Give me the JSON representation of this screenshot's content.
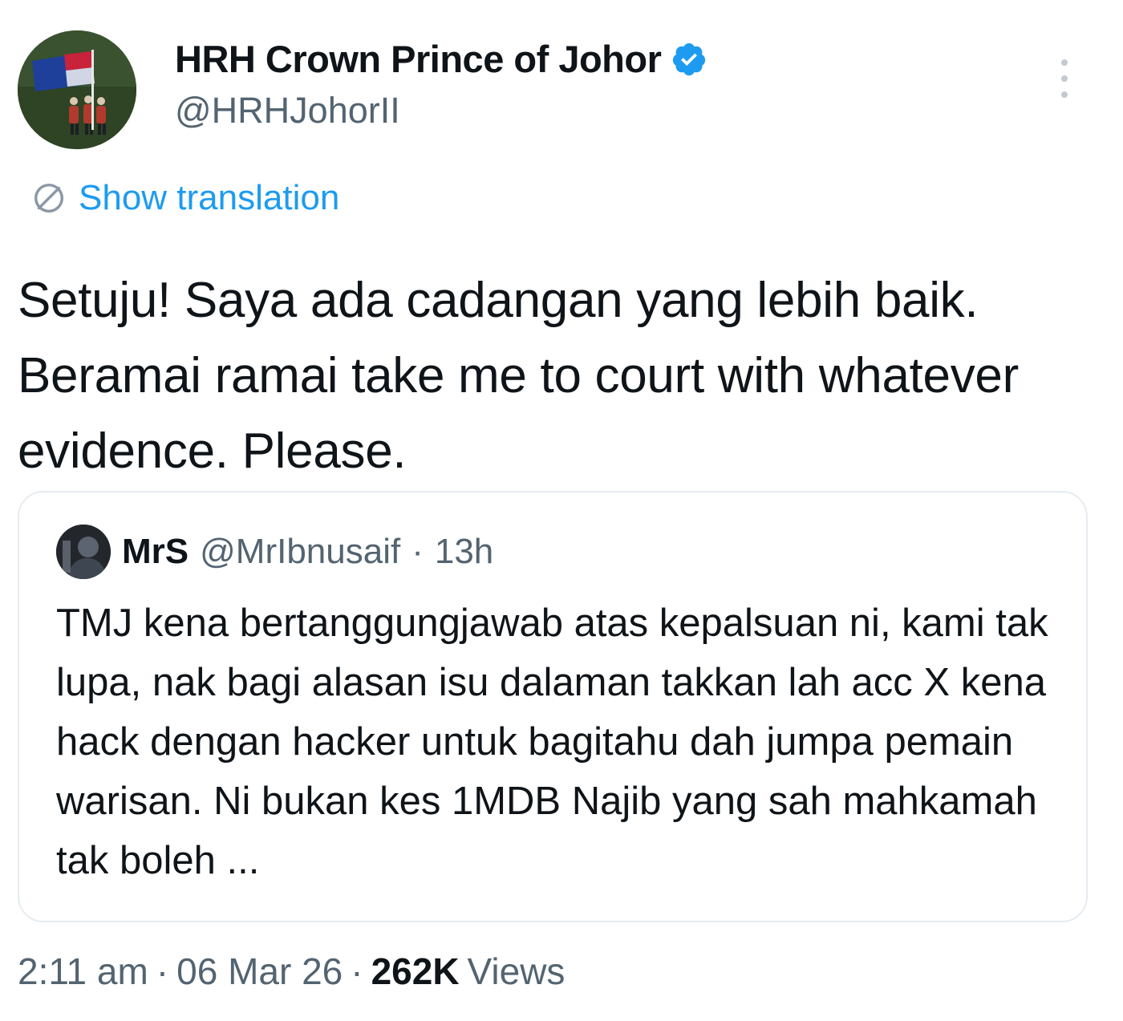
{
  "author": {
    "display_name": "HRH Crown Prince of Johor",
    "handle": "@HRHJohorII",
    "verified": true,
    "verified_color": "#1d9bf0"
  },
  "translation": {
    "label": "Show translation",
    "icon": "globe-icon",
    "color": "#1d9bf0"
  },
  "tweet": {
    "text": "Setuju! Saya ada cadangan yang lebih baik. Beramai ramai take me to court with whatever evidence. Please."
  },
  "quote": {
    "display_name": "MrS",
    "handle": "@MrIbnusaif",
    "separator": "·",
    "time": "13h",
    "text": "TMJ kena bertanggungjawab atas kepalsuan ni, kami tak lupa, nak bagi alasan isu dalaman takkan lah acc X kena hack dengan hacker untuk bagitahu dah jumpa pemain warisan. Ni bukan kes 1MDB Najib yang sah mahkamah tak boleh ..."
  },
  "meta": {
    "time": "2:11 am",
    "separator": "·",
    "date": "06 Mar 26",
    "views_count": "262K",
    "views_label": "Views"
  },
  "icons": {
    "more": "more-vertical-icon",
    "verified": "verified-badge-icon"
  }
}
